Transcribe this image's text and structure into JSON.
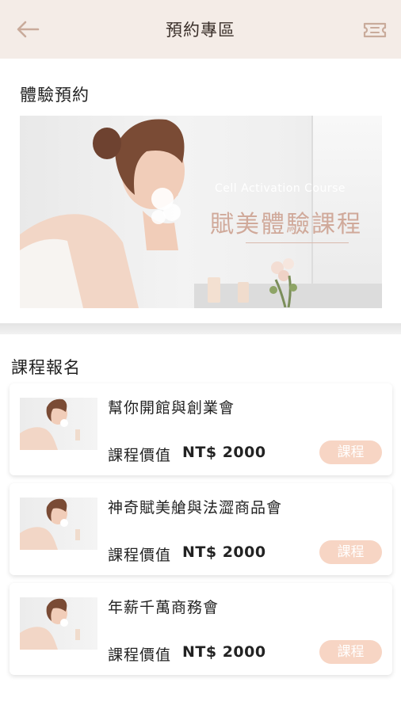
{
  "header": {
    "title": "預約專區",
    "back_icon": "arrow-left-icon",
    "ticket_icon": "ticket-icon"
  },
  "experience": {
    "heading": "體驗預約",
    "banner": {
      "subtitle_en": "Cell Activation Course",
      "title_zh": "賦美體驗課程"
    }
  },
  "courses": {
    "heading": "課程報名",
    "items": [
      {
        "name": "幫你開館與創業會",
        "price_label": "課程價值",
        "price_value": "NT$  2000",
        "button": "課程"
      },
      {
        "name": "神奇賦美艙與法澀商品會",
        "price_label": "課程價值",
        "price_value": "NT$  2000",
        "button": "課程"
      },
      {
        "name": "年薪千萬商務會",
        "price_label": "課程價值",
        "price_value": "NT$  2000",
        "button": "課程"
      }
    ]
  },
  "colors": {
    "header_bg": "#f4ece7",
    "accent": "#f7d5c4",
    "banner_title": "#d0a99a"
  }
}
